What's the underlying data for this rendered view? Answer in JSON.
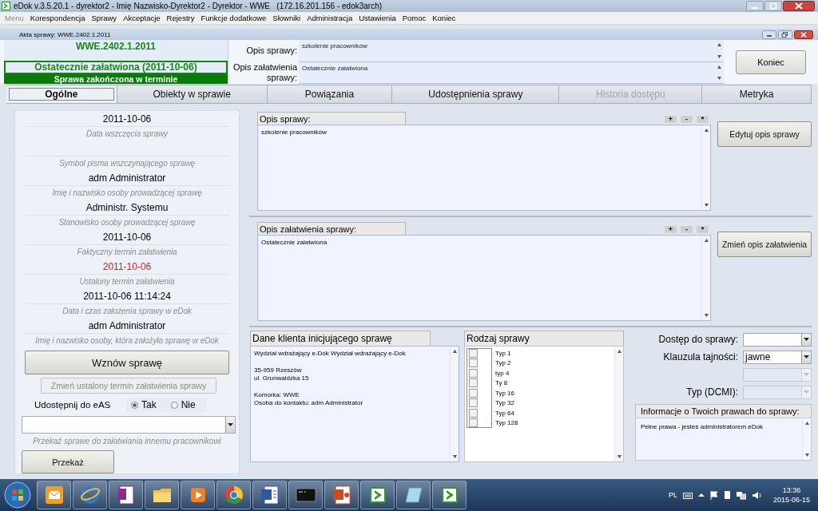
{
  "window": {
    "title": "eDok v.3.5.20.1 - dyrektor2 - Imię Nazwisko-Dyrektor2 - Dyrektor - WWE   (172.16.201.156 - edok3arch)"
  },
  "menu": [
    {
      "label": "Menu",
      "disabled": true
    },
    {
      "label": "Korespondencja",
      "disabled": false
    },
    {
      "label": "Sprawy",
      "disabled": false
    },
    {
      "label": "Akceptacje",
      "disabled": false
    },
    {
      "label": "Rejestry",
      "disabled": false
    },
    {
      "label": "Funkcje dodatkowe",
      "disabled": false
    },
    {
      "label": "Słowniki",
      "disabled": false
    },
    {
      "label": "Administracja",
      "disabled": false
    },
    {
      "label": "Ustawienia",
      "disabled": false
    },
    {
      "label": "Pomoc",
      "disabled": false
    },
    {
      "label": "Koniec",
      "disabled": false
    }
  ],
  "case_window": {
    "title": "Akta sprawy: WWE.2402.1.2011"
  },
  "header": {
    "case_number": "WWE.2402.1.2011",
    "status": "Ostatecznie załatwiona (2011-10-06)",
    "banner": "Sprawa zakończona w terminie",
    "fields": [
      {
        "label": "Opis sprawy:",
        "value": "szkolenie pracowników"
      },
      {
        "label": "Opis załatwienia sprawy:",
        "value": "Ostatecznie załatwiona"
      }
    ],
    "close_button": "Koniec"
  },
  "tabs": [
    {
      "label": "Ogólne",
      "selected": true,
      "disabled": false
    },
    {
      "label": "Obiekty w sprawie",
      "selected": false,
      "disabled": false
    },
    {
      "label": "Powiązania",
      "selected": false,
      "disabled": false
    },
    {
      "label": "Udostępnienia sprawy",
      "selected": false,
      "disabled": false
    },
    {
      "label": "Historia dostępu",
      "selected": false,
      "disabled": true
    },
    {
      "label": "Metryka",
      "selected": false,
      "disabled": false
    }
  ],
  "details": [
    {
      "value": "2011-10-06",
      "caption": "Data wszczęcia sprawy",
      "alert": false
    },
    {
      "caption": "Symbol pisma wszczynającego sprawę"
    },
    {
      "value": "adm Administrator",
      "caption": "Imię i nazwisko osoby prowadzącej sprawę",
      "alert": false
    },
    {
      "value": "Administr. Systemu",
      "caption": "Stanowisko osoby prowadzącej sprawę",
      "alert": false
    },
    {
      "value": "2011-10-06",
      "caption": "Faktyczny termin załatwienia",
      "alert": false
    },
    {
      "value": "2011-10-06",
      "caption": "Ustalony termin załatwienia",
      "alert": true
    },
    {
      "value": "2011-10-06 11:14:24",
      "caption": "Data i czas założenia sprawy w eDok",
      "alert": false
    },
    {
      "value": "adm Administrator",
      "caption": "Imię i nazwisko osoby, która założyła sprawę w eDok",
      "alert": false
    }
  ],
  "resume_button": "Wznów sprawę",
  "change_deadline_button": {
    "label": "Zmień ustalony termin załatwienia sprawy",
    "disabled": true
  },
  "share": {
    "label": "Udostępnij do eAS",
    "options": [
      {
        "label": "Tak",
        "selected": true
      },
      {
        "label": "Nie",
        "selected": false
      }
    ]
  },
  "transfer": {
    "caption": "Przekaż sprawe do załatwiania innemu pracownikowi",
    "button": "Przekaż"
  },
  "memos": [
    {
      "title": "Opis sprawy:",
      "text": "szkolenie pracowników",
      "zoom_buttons": [
        "+",
        "-",
        "*"
      ],
      "button": "Edytuj opis sprawy"
    },
    {
      "title": "Opis załatwienia sprawy:",
      "text": "Ostatecznie załatwiona",
      "zoom_buttons": [
        "+",
        "-",
        "*"
      ],
      "button": "Zmień opis załatwienia"
    }
  ],
  "client": {
    "title": "Dane klienta inicjującego sprawę",
    "paragraphs": [
      [
        "Wydział wdrażający e-Dok Wydział wdrażający e-Dok"
      ],
      [
        "35-959 Rzeszów",
        "ul. Grunwaldzka 15"
      ],
      [
        "Komórka: WWE",
        "Osoba do kontaktu: adm Administrator"
      ]
    ]
  },
  "case_types": {
    "title": "Rodzaj sprawy",
    "items": [
      {
        "label": "Typ 1",
        "checked": false
      },
      {
        "label": "Typ 2",
        "checked": false
      },
      {
        "label": "typ 4",
        "checked": false
      },
      {
        "label": "Ty 8",
        "checked": false
      },
      {
        "label": "Typ 16",
        "checked": false
      },
      {
        "label": "Typ 32",
        "checked": false
      },
      {
        "label": "Typ 64",
        "checked": false
      },
      {
        "label": "Typ 128",
        "checked": false
      }
    ]
  },
  "properties": [
    {
      "label": "Dostęp do sprawy:",
      "disabled": false
    },
    {
      "label": "Klauzula tajności:",
      "value": "jawne",
      "disabled": false
    },
    {
      "disabled": true
    },
    {
      "label": "Typ (DCMI):",
      "disabled": true
    }
  ],
  "rights": {
    "title": "Informacje o Twoich prawach do sprawy:",
    "text": "Pełne prawa - jesteś administratorem eDok"
  },
  "taskbar": {
    "apps": [
      {
        "kind": "mail"
      },
      {
        "kind": "globe"
      },
      {
        "kind": "notebook"
      },
      {
        "kind": "folder"
      },
      {
        "kind": "player"
      },
      {
        "kind": "wheel"
      },
      {
        "kind": "document"
      },
      {
        "kind": "terminal"
      },
      {
        "kind": "slides"
      },
      {
        "kind": "arrow"
      },
      {
        "kind": "notepad"
      },
      {
        "kind": "arrow"
      }
    ],
    "language": "PL",
    "time": "13:36",
    "date": "2015-06-15"
  }
}
